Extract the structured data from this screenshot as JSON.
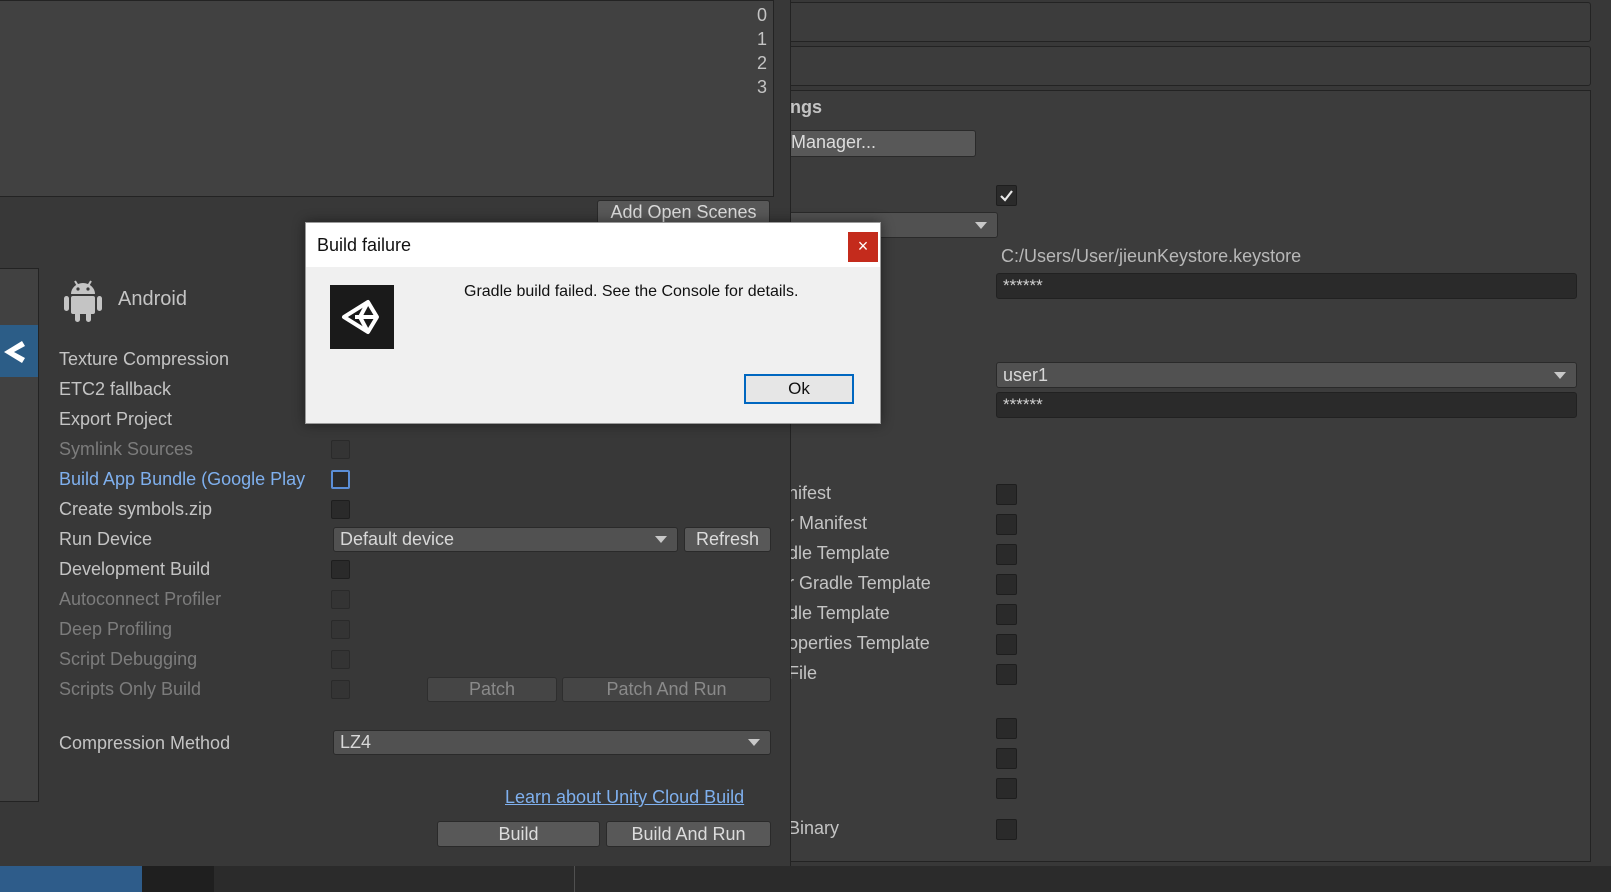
{
  "build_settings": {
    "scene_indices": [
      "0",
      "1",
      "2",
      "3"
    ],
    "add_open_scenes": "Add Open Scenes",
    "platform_name": "Android",
    "rows": {
      "texture_compression": "Texture Compression",
      "etc2_fallback": "ETC2 fallback",
      "export_project": "Export Project",
      "symlink_sources": "Symlink Sources",
      "build_app_bundle": "Build App Bundle (Google Play",
      "create_symbols": "Create symbols.zip",
      "run_device": "Run Device",
      "run_device_value": "Default device",
      "refresh": "Refresh",
      "development_build": "Development Build",
      "autoconnect_profiler": "Autoconnect Profiler",
      "deep_profiling": "Deep Profiling",
      "script_debugging": "Script Debugging",
      "scripts_only_build": "Scripts Only Build",
      "patch": "Patch",
      "patch_and_run": "Patch And Run",
      "compression_method": "Compression Method",
      "compression_value": "LZ4"
    },
    "cloud_build_link": "Learn about Unity Cloud Build",
    "build": "Build",
    "build_and_run": "Build And Run"
  },
  "player_settings": {
    "section_title": "ngs",
    "manager_button": "Manager...",
    "keystore_path": "C:/Users/User/jieunKeystore.keystore",
    "keystore_password": "******",
    "alias_value": "user1",
    "alias_password": "******",
    "labels": [
      "nifest",
      "r Manifest",
      "dle Template",
      "r Gradle Template",
      "dle Template",
      "operties Template",
      "File",
      "Binary"
    ]
  },
  "dialog": {
    "title": "Build failure",
    "close": "×",
    "message": "Gradle build failed.  See the Console for details.",
    "ok": "Ok"
  }
}
